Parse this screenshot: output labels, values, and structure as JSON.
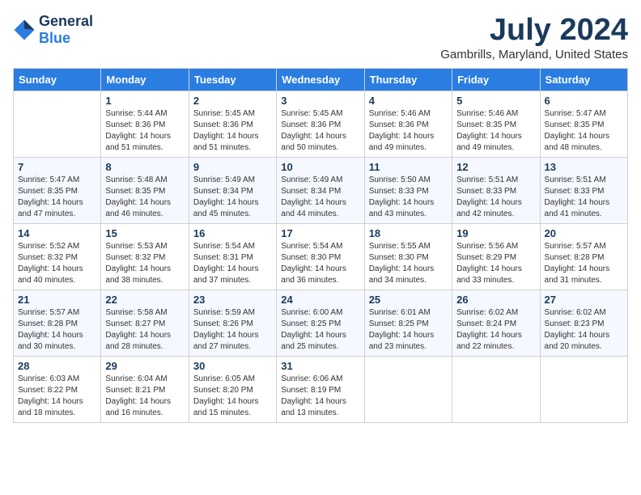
{
  "logo": {
    "text_general": "General",
    "text_blue": "Blue"
  },
  "title": "July 2024",
  "location": "Gambrills, Maryland, United States",
  "days_of_week": [
    "Sunday",
    "Monday",
    "Tuesday",
    "Wednesday",
    "Thursday",
    "Friday",
    "Saturday"
  ],
  "weeks": [
    [
      {
        "day": "",
        "empty": true
      },
      {
        "day": "1",
        "sunrise": "Sunrise: 5:44 AM",
        "sunset": "Sunset: 8:36 PM",
        "daylight": "Daylight: 14 hours and 51 minutes."
      },
      {
        "day": "2",
        "sunrise": "Sunrise: 5:45 AM",
        "sunset": "Sunset: 8:36 PM",
        "daylight": "Daylight: 14 hours and 51 minutes."
      },
      {
        "day": "3",
        "sunrise": "Sunrise: 5:45 AM",
        "sunset": "Sunset: 8:36 PM",
        "daylight": "Daylight: 14 hours and 50 minutes."
      },
      {
        "day": "4",
        "sunrise": "Sunrise: 5:46 AM",
        "sunset": "Sunset: 8:36 PM",
        "daylight": "Daylight: 14 hours and 49 minutes."
      },
      {
        "day": "5",
        "sunrise": "Sunrise: 5:46 AM",
        "sunset": "Sunset: 8:35 PM",
        "daylight": "Daylight: 14 hours and 49 minutes."
      },
      {
        "day": "6",
        "sunrise": "Sunrise: 5:47 AM",
        "sunset": "Sunset: 8:35 PM",
        "daylight": "Daylight: 14 hours and 48 minutes."
      }
    ],
    [
      {
        "day": "7",
        "sunrise": "Sunrise: 5:47 AM",
        "sunset": "Sunset: 8:35 PM",
        "daylight": "Daylight: 14 hours and 47 minutes."
      },
      {
        "day": "8",
        "sunrise": "Sunrise: 5:48 AM",
        "sunset": "Sunset: 8:35 PM",
        "daylight": "Daylight: 14 hours and 46 minutes."
      },
      {
        "day": "9",
        "sunrise": "Sunrise: 5:49 AM",
        "sunset": "Sunset: 8:34 PM",
        "daylight": "Daylight: 14 hours and 45 minutes."
      },
      {
        "day": "10",
        "sunrise": "Sunrise: 5:49 AM",
        "sunset": "Sunset: 8:34 PM",
        "daylight": "Daylight: 14 hours and 44 minutes."
      },
      {
        "day": "11",
        "sunrise": "Sunrise: 5:50 AM",
        "sunset": "Sunset: 8:33 PM",
        "daylight": "Daylight: 14 hours and 43 minutes."
      },
      {
        "day": "12",
        "sunrise": "Sunrise: 5:51 AM",
        "sunset": "Sunset: 8:33 PM",
        "daylight": "Daylight: 14 hours and 42 minutes."
      },
      {
        "day": "13",
        "sunrise": "Sunrise: 5:51 AM",
        "sunset": "Sunset: 8:33 PM",
        "daylight": "Daylight: 14 hours and 41 minutes."
      }
    ],
    [
      {
        "day": "14",
        "sunrise": "Sunrise: 5:52 AM",
        "sunset": "Sunset: 8:32 PM",
        "daylight": "Daylight: 14 hours and 40 minutes."
      },
      {
        "day": "15",
        "sunrise": "Sunrise: 5:53 AM",
        "sunset": "Sunset: 8:32 PM",
        "daylight": "Daylight: 14 hours and 38 minutes."
      },
      {
        "day": "16",
        "sunrise": "Sunrise: 5:54 AM",
        "sunset": "Sunset: 8:31 PM",
        "daylight": "Daylight: 14 hours and 37 minutes."
      },
      {
        "day": "17",
        "sunrise": "Sunrise: 5:54 AM",
        "sunset": "Sunset: 8:30 PM",
        "daylight": "Daylight: 14 hours and 36 minutes."
      },
      {
        "day": "18",
        "sunrise": "Sunrise: 5:55 AM",
        "sunset": "Sunset: 8:30 PM",
        "daylight": "Daylight: 14 hours and 34 minutes."
      },
      {
        "day": "19",
        "sunrise": "Sunrise: 5:56 AM",
        "sunset": "Sunset: 8:29 PM",
        "daylight": "Daylight: 14 hours and 33 minutes."
      },
      {
        "day": "20",
        "sunrise": "Sunrise: 5:57 AM",
        "sunset": "Sunset: 8:28 PM",
        "daylight": "Daylight: 14 hours and 31 minutes."
      }
    ],
    [
      {
        "day": "21",
        "sunrise": "Sunrise: 5:57 AM",
        "sunset": "Sunset: 8:28 PM",
        "daylight": "Daylight: 14 hours and 30 minutes."
      },
      {
        "day": "22",
        "sunrise": "Sunrise: 5:58 AM",
        "sunset": "Sunset: 8:27 PM",
        "daylight": "Daylight: 14 hours and 28 minutes."
      },
      {
        "day": "23",
        "sunrise": "Sunrise: 5:59 AM",
        "sunset": "Sunset: 8:26 PM",
        "daylight": "Daylight: 14 hours and 27 minutes."
      },
      {
        "day": "24",
        "sunrise": "Sunrise: 6:00 AM",
        "sunset": "Sunset: 8:25 PM",
        "daylight": "Daylight: 14 hours and 25 minutes."
      },
      {
        "day": "25",
        "sunrise": "Sunrise: 6:01 AM",
        "sunset": "Sunset: 8:25 PM",
        "daylight": "Daylight: 14 hours and 23 minutes."
      },
      {
        "day": "26",
        "sunrise": "Sunrise: 6:02 AM",
        "sunset": "Sunset: 8:24 PM",
        "daylight": "Daylight: 14 hours and 22 minutes."
      },
      {
        "day": "27",
        "sunrise": "Sunrise: 6:02 AM",
        "sunset": "Sunset: 8:23 PM",
        "daylight": "Daylight: 14 hours and 20 minutes."
      }
    ],
    [
      {
        "day": "28",
        "sunrise": "Sunrise: 6:03 AM",
        "sunset": "Sunset: 8:22 PM",
        "daylight": "Daylight: 14 hours and 18 minutes."
      },
      {
        "day": "29",
        "sunrise": "Sunrise: 6:04 AM",
        "sunset": "Sunset: 8:21 PM",
        "daylight": "Daylight: 14 hours and 16 minutes."
      },
      {
        "day": "30",
        "sunrise": "Sunrise: 6:05 AM",
        "sunset": "Sunset: 8:20 PM",
        "daylight": "Daylight: 14 hours and 15 minutes."
      },
      {
        "day": "31",
        "sunrise": "Sunrise: 6:06 AM",
        "sunset": "Sunset: 8:19 PM",
        "daylight": "Daylight: 14 hours and 13 minutes."
      },
      {
        "day": "",
        "empty": true
      },
      {
        "day": "",
        "empty": true
      },
      {
        "day": "",
        "empty": true
      }
    ]
  ]
}
